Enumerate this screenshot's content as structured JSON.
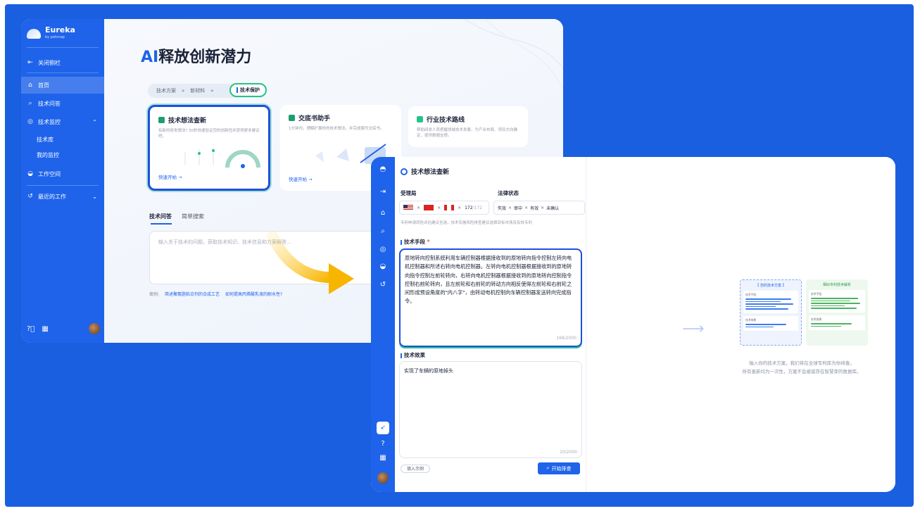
{
  "window1": {
    "brand": {
      "name": "Eureka",
      "sub": "by patsnap"
    },
    "sidebar": {
      "collapse_label": "关闭侧栏",
      "items": [
        {
          "icon": "home-icon",
          "label": "首页"
        },
        {
          "icon": "search-icon",
          "label": "技术问答"
        },
        {
          "icon": "monitor-icon",
          "label": "技术监控"
        },
        {
          "icon": "workspace-icon",
          "label": "工作空间"
        },
        {
          "icon": "history-icon",
          "label": "最近的工作"
        }
      ],
      "sub_items": [
        "技术库",
        "我的监控"
      ]
    },
    "hero": {
      "ai": "AI",
      "title": "释放创新潜力"
    },
    "breadcrumb": [
      "技术方案",
      "新材料"
    ],
    "breadcrumb_active": "技术保护",
    "cards": [
      {
        "title": "技术想法查新",
        "desc": "有新的研发想法? 30秒快速验证您的创新性并获得更多建议吧。",
        "go": "快速开始 →"
      },
      {
        "title": "交底书助手",
        "desc": "1分钟内，理解扩展你的技术想法，并完成撰写交底书。",
        "go": "快速开始 →"
      },
      {
        "title": "行业技术路线",
        "desc": "帮助研发人员把握领域技术发展，为产业布局、项目方向确定，提供数据支撑。"
      }
    ],
    "tabs": [
      "技术问答",
      "简单搜索"
    ],
    "ask_placeholder": "输入关于技术的问题，获取技术知识、技术信息和方案解答...",
    "examples": {
      "label": "案例:",
      "items": [
        "简述聚氨脂粘合剂的合成工艺",
        "如何提高丙烯酸乳液的耐水性?"
      ]
    }
  },
  "window2": {
    "title": "技术想法查新",
    "authority_label": "受理局",
    "authority_count": "172",
    "authority_total": "/172",
    "status_label": "法律状态",
    "status_chips": [
      "失效",
      "审中",
      "有效",
      "未确认"
    ],
    "hint": "专利申请风险评估建议全选，技术实施风险排查建议选择目标市场及有效专利",
    "tech_label": "技术手段",
    "tech_required": "*",
    "tech_text": "原地转向控制系统利用车辆控制器根据接收到的原地转向指令控制左转向电机控制器和所述右转向电机控制器。左转向电机控制器根据接收到的原地转向指令控制左前轮转向，右转向电机控制器根据接收到的原地转向控制指令控制右前轮转向，且左前轮和右前轮的转动方向相反使得左前轮和右前轮之间形成预设角度的\"内八字\"，由转动电机控制向车辆控制器发送转向完成指令。",
    "tech_count": "168/2000",
    "effect_label": "技术效果",
    "effect_text": "实现了车辆的原地掉头",
    "effect_count": "10/2000",
    "btn_example": "填入示例",
    "btn_submit": "开始排查",
    "preview": {
      "left_head": "【 您的技术方案 】",
      "right_head": "相似专利技术解析",
      "sec1": "技术手段",
      "sec2": "技术效果",
      "caption_line1": "输入你的技术方案，我们将在全球专利库为你排查。",
      "caption_line2": "所有查新均为一次性，方案不会被留存在智慧芽的数据库。"
    }
  },
  "colors": {
    "brand_blue": "#1e63ea",
    "accent_green": "#27c28a",
    "arrow_yellow": "#f7b500"
  }
}
